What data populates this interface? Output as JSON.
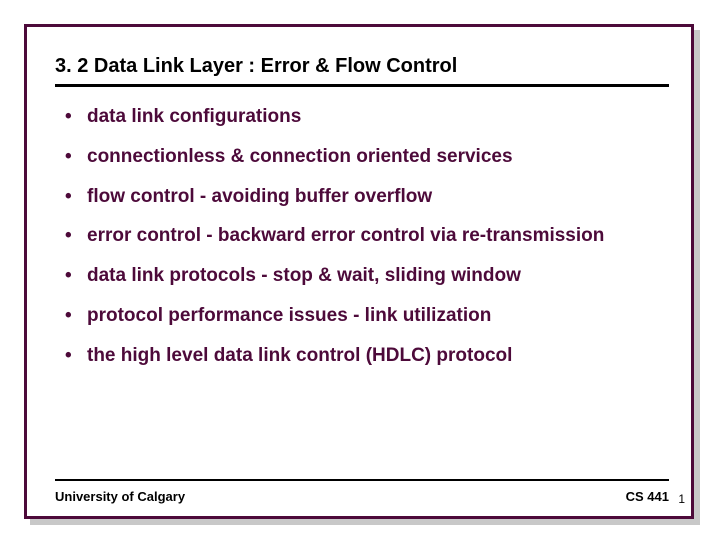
{
  "title": "3. 2 Data Link Layer : Error & Flow Control",
  "bullets": [
    "data link configurations",
    "connectionless & connection oriented services",
    "flow control - avoiding buffer overflow",
    "error control - backward error control via re-transmission",
    "data link protocols - stop & wait, sliding window",
    "protocol performance issues - link utilization",
    "the high level data link control (HDLC) protocol"
  ],
  "footer": {
    "left": "University of Calgary",
    "right": "CS 441"
  },
  "page": "1"
}
